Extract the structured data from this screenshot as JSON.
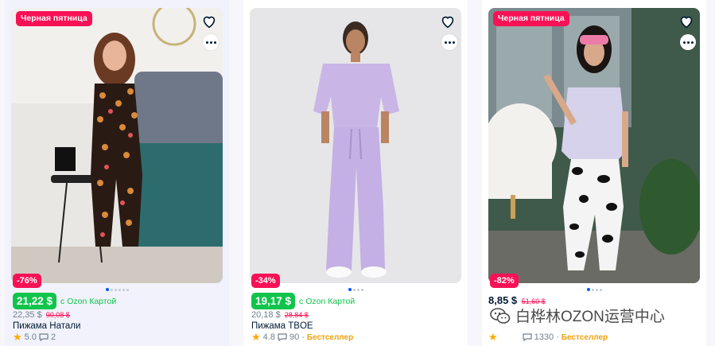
{
  "products": [
    {
      "promo_badge": "Черная пятница",
      "discount": "-76%",
      "card_price": "21,22 $",
      "card_label": "с Ozon Картой",
      "price": "22,35 $",
      "old_price": "90,08 $",
      "title": "Пижама Натали",
      "rating": "5.0",
      "reviews": "2",
      "badge": ""
    },
    {
      "promo_badge": "",
      "discount": "-34%",
      "card_price": "19,17 $",
      "card_label": "с Ozon Картой",
      "price": "20,18 $",
      "old_price": "28,84 $",
      "title": "Пижама TBOE",
      "rating": "4.8",
      "reviews": "90",
      "badge": "Бестселлер"
    },
    {
      "promo_badge": "Черная пятница",
      "discount": "-82%",
      "price": "8,85 $",
      "old_price": "51,60 $",
      "reviews": "1330",
      "badge": "Бестселлер"
    }
  ],
  "watermark": "白桦林OZON运营中心",
  "icons": {
    "favorite": "heart-icon",
    "more": "more-icon",
    "rating": "star-icon",
    "reviews": "comment-icon"
  },
  "colors": {
    "promo": "#f91155",
    "green_price": "#10c44c",
    "rating_star": "#ffa800",
    "bestseller": "#f1a10c"
  }
}
